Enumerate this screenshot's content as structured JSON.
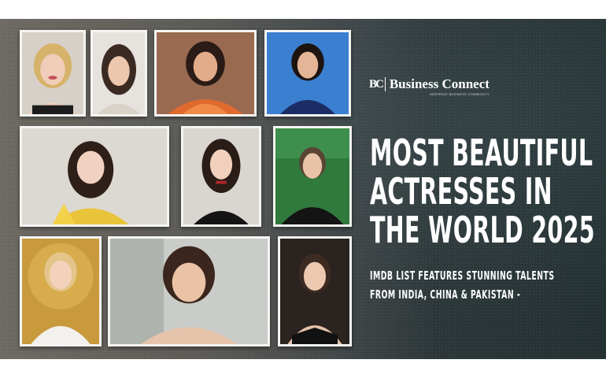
{
  "logo": {
    "mark": "BC",
    "name": "Business Connect",
    "tagline": "INSPIRING BUSINESS COMMUNITY"
  },
  "headline": {
    "lines": [
      "MOST BEAUTIFUL",
      "ACTRESSES IN",
      "THE WORLD 2025"
    ]
  },
  "subheadline": {
    "lines": [
      "IMDB LIST FEATURES STUNNING TALENTS",
      "FROM INDIA, CHINA & PAKISTAN -"
    ]
  },
  "colors": {
    "background_dark": "#233032",
    "background_grey": "#6e6a63",
    "photo_border": "#f4f4f2",
    "text": "#ffffff"
  }
}
